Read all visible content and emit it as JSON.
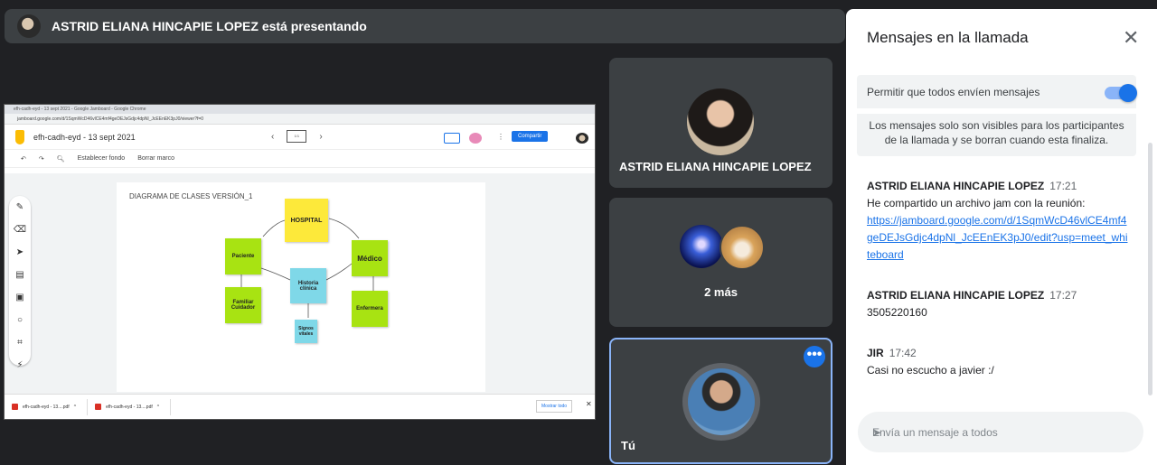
{
  "banner": {
    "text": "ASTRID ELIANA HINCAPIE LOPEZ está presentando"
  },
  "screen": {
    "tab_title": "efh-cadh-eyd - 13 sept 2021 - Google Jamboard - Google Chrome",
    "url": "jamboard.google.com/d/1SqmWcD46vlCE4mf4geDEJsGdjc4dpNl_JcEEnEK3pJ0/viewer?f=0",
    "jam_title": "efh-cadh-eyd - 13 sept 2021",
    "frame_label": "1/1",
    "share_label": "Compartir",
    "toolbar": {
      "set_bg": "Establecer fondo",
      "clear": "Borrar marco"
    },
    "board_title": "DIAGRAMA DE CLASES VERSIÓN_1",
    "notes": {
      "hospital": "HOSPITAL",
      "paciente": "Paciente",
      "historia": "Historia clínica",
      "medico": "Médico",
      "familiar": "Familiar Cuidador",
      "enfermera": "Enfermera",
      "signos": "Signos vitales"
    },
    "downloads": [
      "efh-cadh-eyd - 13....pdf",
      "efh-cadh-eyd - 13....pdf"
    ],
    "show_all": "Mostrar todo"
  },
  "tiles": {
    "presenter_name": "ASTRID ELIANA HINCAPIE LOPEZ",
    "more_label": "2 más",
    "self_label": "Tú"
  },
  "chat": {
    "title": "Mensajes en la llamada",
    "toggle_label": "Permitir que todos envíen mensajes",
    "toggle_on": true,
    "notice": "Los mensajes solo son visibles para los participantes de la llamada y se borran cuando esta finaliza.",
    "messages": [
      {
        "sender": "ASTRID ELIANA HINCAPIE LOPEZ",
        "time": "17:21",
        "text": "He compartido un archivo jam con la reunión:",
        "link": "https://jamboard.google.com/d/1SqmWcD46vlCE4mf4geDEJsGdjc4dpNl_JcEEnEK3pJ0/edit?usp=meet_whiteboard"
      },
      {
        "sender": "ASTRID ELIANA HINCAPIE LOPEZ",
        "time": "17:27",
        "text": "3505220160"
      },
      {
        "sender": "JIR",
        "time": "17:42",
        "text": "Casi no escucho a javier :/"
      }
    ],
    "input_placeholder": "Envía un mensaje a todos"
  },
  "colors": {
    "accent": "#1a73e8",
    "tile_bg": "#3c4043",
    "page_bg": "#202124",
    "sticky_yellow": "#fde93a",
    "sticky_green": "#a8e312",
    "sticky_cyan": "#7fd8e8"
  }
}
